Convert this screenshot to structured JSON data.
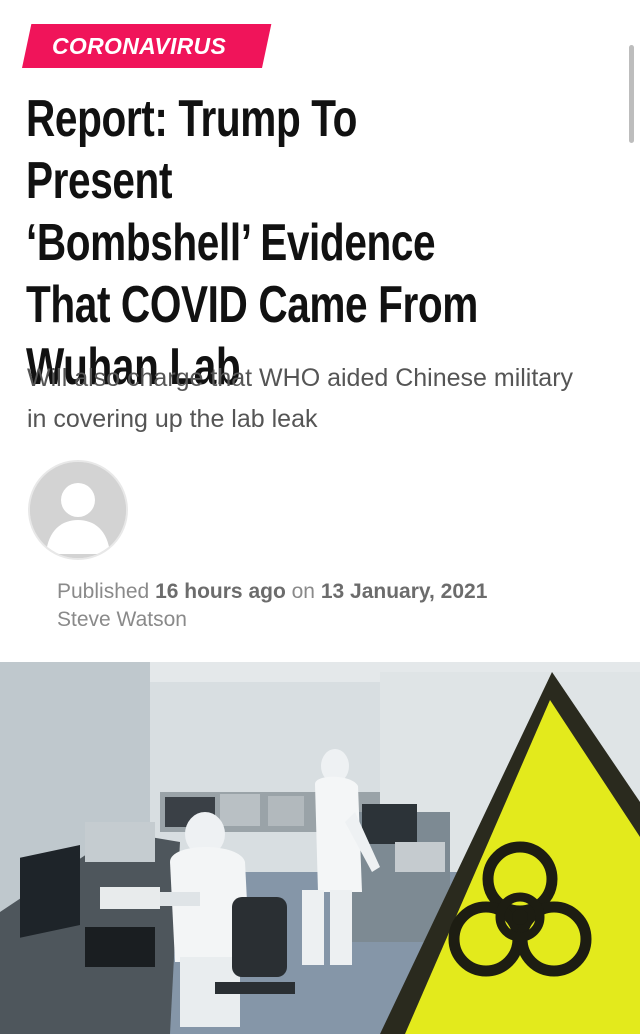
{
  "article": {
    "category": "CORONAVIRUS",
    "headline": "Report: Trump To Present\n‘Bombshell’ Evidence\nThat COVID Came From\nWuhan Lab",
    "subtitle": "Will also charge that WHO aided Chinese military in covering up the lab leak",
    "meta": {
      "published_prefix": "Published",
      "relative_time": "16 hours ago",
      "date_prefix": "on",
      "date": "13 January, 2021",
      "author": "Steve Watson"
    }
  },
  "colors": {
    "category_bg": "#f0145a",
    "biohazard_yellow": "#e3ea1c"
  },
  "icons": {
    "avatar": "user-placeholder-icon",
    "hazard": "biohazard-icon"
  }
}
